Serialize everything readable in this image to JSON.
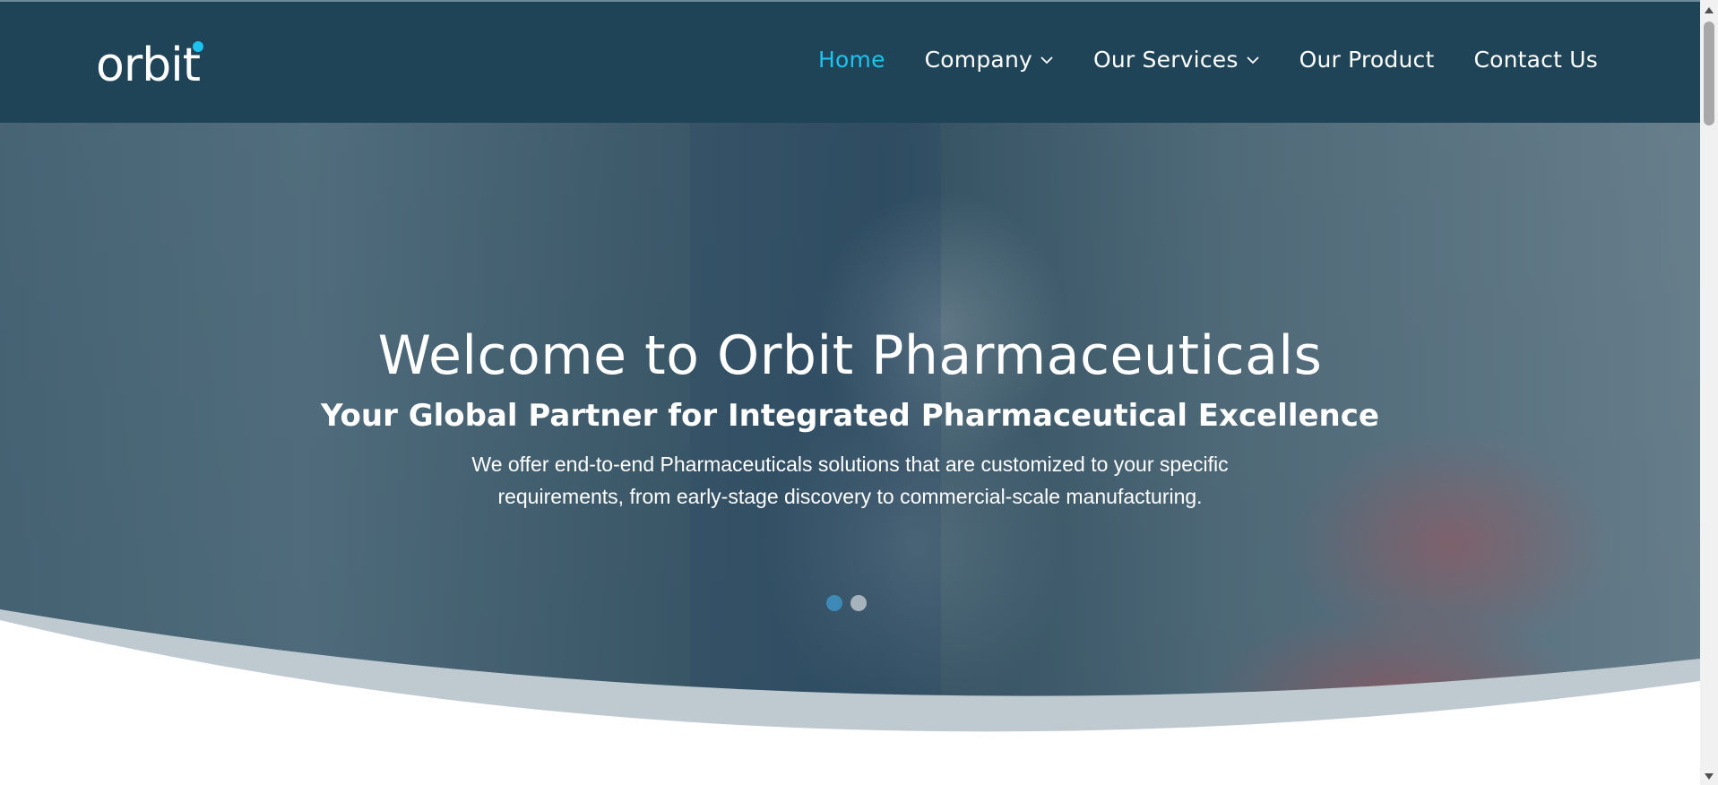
{
  "header": {
    "logo": {
      "text": "orbit",
      "icon": "orbit-logo",
      "accent_color": "#1cc3ef"
    },
    "nav": [
      {
        "label": "Home",
        "active": true,
        "dropdown": false
      },
      {
        "label": "Company",
        "active": false,
        "dropdown": true
      },
      {
        "label": "Our Services",
        "active": false,
        "dropdown": true
      },
      {
        "label": "Our Product",
        "active": false,
        "dropdown": false
      },
      {
        "label": "Contact Us",
        "active": false,
        "dropdown": false
      }
    ],
    "background_color": "#1f4457",
    "active_color": "#1cc3ef"
  },
  "hero": {
    "title": "Welcome to Orbit Pharmaceuticals",
    "subtitle": "Your Global Partner for Integrated Pharmaceutical Excellence",
    "description_lines": [
      "We offer end-to-end Pharmaceuticals solutions that are customized to your specific",
      "requirements, from early-stage discovery to commercial-scale manufacturing."
    ],
    "slider": {
      "slides": 2,
      "active_index": 0
    }
  }
}
